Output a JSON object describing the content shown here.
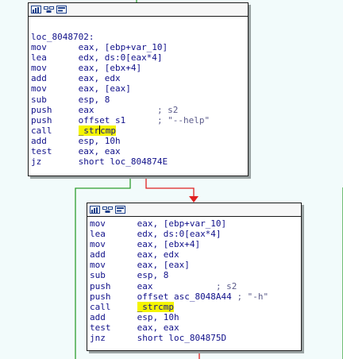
{
  "colors": {
    "background": "#f2fbfb",
    "node_border": "#1a1a1a",
    "text": "#11118a",
    "comment": "#5b5b8a",
    "highlight": "#f4f400",
    "edge_true": "#2e9e2e",
    "edge_false": "#e02020"
  },
  "header_icons": [
    "graph-color-icon",
    "node-group-icon",
    "node-view-icon"
  ],
  "block1": {
    "label": "loc_8048702:",
    "lines": [
      {
        "m": "mov",
        "op": "eax, [ebp+var_10]"
      },
      {
        "m": "lea",
        "op": "edx, ds:0[eax*4]"
      },
      {
        "m": "mov",
        "op": "eax, [ebx+4]"
      },
      {
        "m": "add",
        "op": "eax, edx"
      },
      {
        "m": "mov",
        "op": "eax, [eax]"
      },
      {
        "m": "sub",
        "op": "esp, 8"
      },
      {
        "m": "push",
        "op": "eax            ",
        "cmt": "; s2"
      },
      {
        "m": "push",
        "op": "offset s1      ",
        "cmt": "; \"--help\""
      },
      {
        "m": "call",
        "hl_pre": "_str",
        "hl_post": "cmp"
      },
      {
        "m": "add",
        "op": "esp, 10h"
      },
      {
        "m": "test",
        "op": "eax, eax"
      },
      {
        "m": "jz",
        "op": "short loc_804874E"
      }
    ]
  },
  "block2": {
    "lines": [
      {
        "m": "mov",
        "op": "eax, [ebp+var_10]"
      },
      {
        "m": "lea",
        "op": "edx, ds:0[eax*4]"
      },
      {
        "m": "mov",
        "op": "eax, [ebx+4]"
      },
      {
        "m": "add",
        "op": "eax, edx"
      },
      {
        "m": "mov",
        "op": "eax, [eax]"
      },
      {
        "m": "sub",
        "op": "esp, 8"
      },
      {
        "m": "push",
        "op": "eax            ",
        "cmt": "; s2"
      },
      {
        "m": "push",
        "op": "offset asc_8048A44 ",
        "cmt": "; \"-h\""
      },
      {
        "m": "call",
        "hl": "_strcmp"
      },
      {
        "m": "add",
        "op": "esp, 10h"
      },
      {
        "m": "test",
        "op": "eax, eax"
      },
      {
        "m": "jnz",
        "op": "short loc_804875D"
      }
    ]
  }
}
